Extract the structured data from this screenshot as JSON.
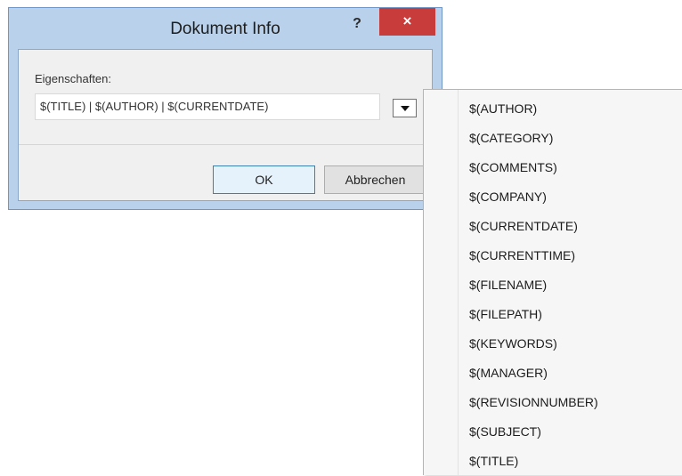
{
  "dialog": {
    "title": "Dokument Info",
    "help_label": "?",
    "close_label": "×",
    "properties_label": "Eigenschaften:",
    "properties_value": "$(TITLE) | $(AUTHOR) | $(CURRENTDATE)",
    "ok_label": "OK",
    "cancel_label": "Abbrechen"
  },
  "menu": {
    "items": [
      "$(AUTHOR)",
      "$(CATEGORY)",
      "$(COMMENTS)",
      "$(COMPANY)",
      "$(CURRENTDATE)",
      "$(CURRENTTIME)",
      "$(FILENAME)",
      "$(FILEPATH)",
      "$(KEYWORDS)",
      "$(MANAGER)",
      "$(REVISIONNUMBER)",
      "$(SUBJECT)",
      "$(TITLE)"
    ]
  },
  "colors": {
    "frame": "#b9d1ea",
    "close": "#c83c3c",
    "focus_border": "#3c7fb1"
  },
  "icons": {
    "dropdown": "chevron-down-icon",
    "close": "close-icon",
    "help": "help-icon"
  }
}
